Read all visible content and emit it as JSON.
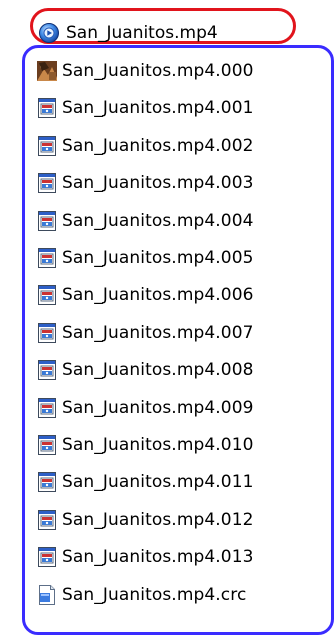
{
  "top_file": {
    "name": "San_Juanitos.mp4",
    "icon": "media-player-icon"
  },
  "files": [
    {
      "name": "San_Juanitos.mp4.000",
      "icon": "media-thumbnail-icon"
    },
    {
      "name": "San_Juanitos.mp4.001",
      "icon": "generic-file-icon"
    },
    {
      "name": "San_Juanitos.mp4.002",
      "icon": "generic-file-icon"
    },
    {
      "name": "San_Juanitos.mp4.003",
      "icon": "generic-file-icon"
    },
    {
      "name": "San_Juanitos.mp4.004",
      "icon": "generic-file-icon"
    },
    {
      "name": "San_Juanitos.mp4.005",
      "icon": "generic-file-icon"
    },
    {
      "name": "San_Juanitos.mp4.006",
      "icon": "generic-file-icon"
    },
    {
      "name": "San_Juanitos.mp4.007",
      "icon": "generic-file-icon"
    },
    {
      "name": "San_Juanitos.mp4.008",
      "icon": "generic-file-icon"
    },
    {
      "name": "San_Juanitos.mp4.009",
      "icon": "generic-file-icon"
    },
    {
      "name": "San_Juanitos.mp4.010",
      "icon": "generic-file-icon"
    },
    {
      "name": "San_Juanitos.mp4.011",
      "icon": "generic-file-icon"
    },
    {
      "name": "San_Juanitos.mp4.012",
      "icon": "generic-file-icon"
    },
    {
      "name": "San_Juanitos.mp4.013",
      "icon": "generic-file-icon"
    },
    {
      "name": "San_Juanitos.mp4.crc",
      "icon": "text-file-icon"
    }
  ],
  "colors": {
    "red_outline": "#e1141c",
    "blue_outline": "#3a2cff"
  }
}
